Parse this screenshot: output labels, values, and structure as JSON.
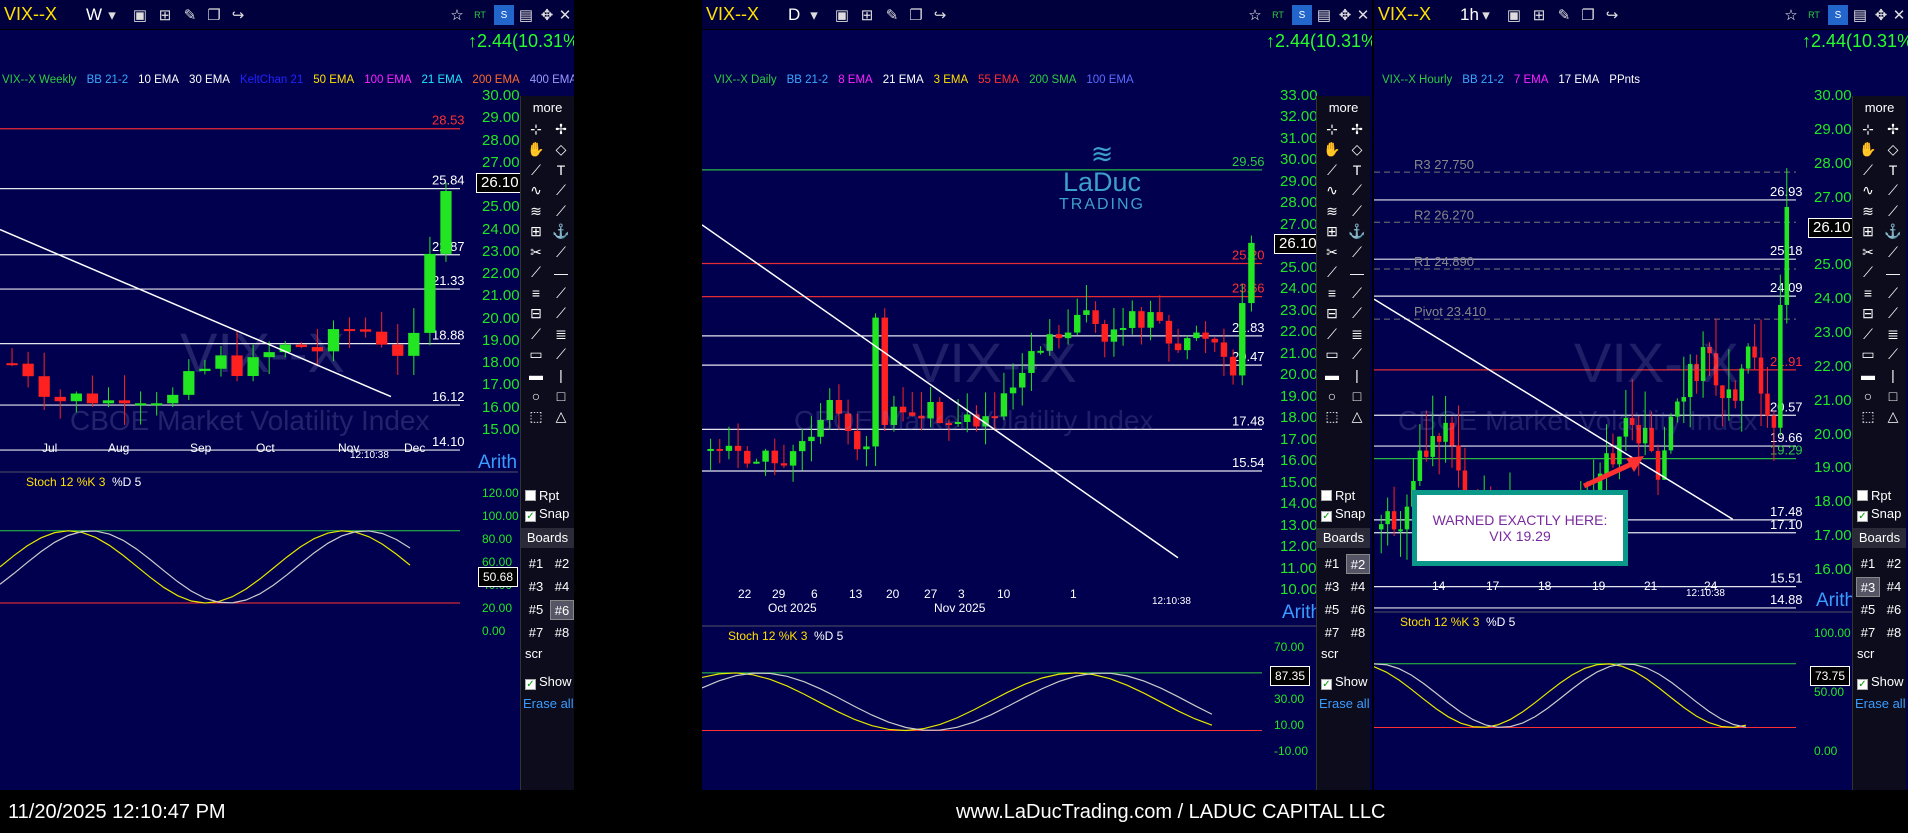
{
  "panels": [
    {
      "id": "weekly",
      "symbol": "VIX--X",
      "period": "W",
      "change": "↑2.44(10.31%)",
      "legend": [
        {
          "t": "VIX--X Weekly",
          "c": "#2ecc40"
        },
        {
          "t": "BB 21-2",
          "c": "#3aa8ff"
        },
        {
          "t": "10 EMA",
          "c": "#ffffff"
        },
        {
          "t": "30 EMA",
          "c": "#ffffff"
        },
        {
          "t": "KeltChan 21",
          "c": "#2222ff"
        },
        {
          "t": "50 EMA",
          "c": "#ffe000"
        },
        {
          "t": "100 EMA",
          "c": "#ff22ff"
        },
        {
          "t": "21 EMA",
          "c": "#22e6ff"
        },
        {
          "t": "200 EMA",
          "c": "#ff6a2a"
        },
        {
          "t": "400 EMA",
          "c": "#9a9aff"
        }
      ],
      "yaxis": [
        "30.00",
        "29.00",
        "28.00",
        "27.00",
        "26.00",
        "25.00",
        "24.00",
        "23.00",
        "22.00",
        "21.00",
        "20.00",
        "19.00",
        "18.00",
        "17.00",
        "16.00",
        "15.00"
      ],
      "levels": [
        {
          "v": "28.53",
          "c": "#ff3030"
        },
        {
          "v": "25.84",
          "c": "#ffffff"
        },
        {
          "v": "22.87",
          "c": "#ffffff"
        },
        {
          "v": "21.33",
          "c": "#ffffff"
        },
        {
          "v": "18.88",
          "c": "#ffffff"
        },
        {
          "v": "16.12",
          "c": "#ffffff"
        },
        {
          "v": "14.10",
          "c": "#ffffff"
        }
      ],
      "price": "26.10",
      "xaxis": [
        "Jul",
        "Aug",
        "Sep",
        "Oct",
        "Nov",
        "Dec"
      ],
      "time": "12:10:38",
      "ind_title": "Stoch 12 %K 3",
      "ind_title2": "%D 5",
      "ind_axis": [
        "120.00",
        "100.00",
        "80.00",
        "60.00",
        "40.00",
        "20.00",
        "0.00"
      ],
      "ind_value": "50.68",
      "watermark": "VIX--X",
      "watermark2": "CBOE Market Volatility Index"
    },
    {
      "id": "daily",
      "symbol": "VIX--X",
      "period": "D",
      "change": "↑2.44(10.31%)",
      "legend": [
        {
          "t": "VIX--X Daily",
          "c": "#2ecc40"
        },
        {
          "t": "BB 21-2",
          "c": "#3aa8ff"
        },
        {
          "t": "8 EMA",
          "c": "#ff22ff"
        },
        {
          "t": "21 EMA",
          "c": "#ffffff"
        },
        {
          "t": "3 EMA",
          "c": "#ffe000"
        },
        {
          "t": "55 EMA",
          "c": "#ff3030"
        },
        {
          "t": "200 SMA",
          "c": "#2ecc40"
        },
        {
          "t": "100 EMA",
          "c": "#5a6aff"
        }
      ],
      "yaxis": [
        "33.00",
        "32.00",
        "31.00",
        "30.00",
        "29.00",
        "28.00",
        "27.00",
        "26.00",
        "25.00",
        "24.00",
        "23.00",
        "22.00",
        "21.00",
        "20.00",
        "19.00",
        "18.00",
        "17.00",
        "16.00",
        "15.00",
        "14.00",
        "13.00",
        "12.00",
        "11.00",
        "10.00"
      ],
      "levels": [
        {
          "v": "29.56",
          "c": "#2ecc40"
        },
        {
          "v": "25.20",
          "c": "#ff3030"
        },
        {
          "v": "23.66",
          "c": "#ff3030"
        },
        {
          "v": "21.83",
          "c": "#ffffff"
        },
        {
          "v": "20.47",
          "c": "#ffffff"
        },
        {
          "v": "17.48",
          "c": "#ffffff"
        },
        {
          "v": "15.54",
          "c": "#ffffff"
        }
      ],
      "price": "26.10",
      "xaxis": [
        "22",
        "29",
        "6",
        "13",
        "20",
        "27",
        "3",
        "10",
        "1"
      ],
      "xaxis2": [
        "Oct 2025",
        "Nov 2025"
      ],
      "time": "12:10:38",
      "ind_title": "Stoch 12 %K 3",
      "ind_title2": "%D 5",
      "ind_axis": [
        "70.00",
        "50.00",
        "30.00",
        "10.00",
        "-10.00"
      ],
      "ind_value": "87.35",
      "watermark": "VIX--X",
      "watermark2": "CBOE Market Volatility Index",
      "brand": "LaDuc",
      "brand2": "TRADING"
    },
    {
      "id": "hourly",
      "symbol": "VIX--X",
      "period": "1h",
      "change": "↑2.44(10.31%)",
      "legend": [
        {
          "t": "VIX--X Hourly",
          "c": "#2ecc40"
        },
        {
          "t": "BB 21-2",
          "c": "#3aa8ff"
        },
        {
          "t": "7 EMA",
          "c": "#ff22ff"
        },
        {
          "t": "17 EMA",
          "c": "#ffffff"
        },
        {
          "t": "PPnts",
          "c": "#ffffff"
        }
      ],
      "yaxis": [
        "30.00",
        "29.00",
        "28.00",
        "27.00",
        "26.00",
        "25.00",
        "24.00",
        "23.00",
        "22.00",
        "21.00",
        "20.00",
        "19.00",
        "18.00",
        "17.00",
        "16.00"
      ],
      "levels": [
        {
          "v": "26.93",
          "c": "#ffffff"
        },
        {
          "v": "25.18",
          "c": "#ffffff"
        },
        {
          "v": "24.09",
          "c": "#ffffff"
        },
        {
          "v": "21.91",
          "c": "#ff3030"
        },
        {
          "v": "20.57",
          "c": "#ffffff"
        },
        {
          "v": "19.66",
          "c": "#ffffff"
        },
        {
          "v": "19.29",
          "c": "#2ecc40"
        },
        {
          "v": "17.48",
          "c": "#ffffff"
        },
        {
          "v": "17.10",
          "c": "#ffffff"
        },
        {
          "v": "15.51",
          "c": "#ffffff"
        },
        {
          "v": "14.88",
          "c": "#ffffff"
        }
      ],
      "pivots": [
        {
          "t": "R3 27.750"
        },
        {
          "t": "R2 26.270"
        },
        {
          "t": "R1 24.890"
        },
        {
          "t": "Pivot 23.410"
        }
      ],
      "price": "26.10",
      "xaxis": [
        "14",
        "17",
        "18",
        "19",
        "21",
        "24"
      ],
      "time": "12:10:38",
      "ind_title": "Stoch 12 %K 3",
      "ind_title2": "%D 5",
      "ind_axis": [
        "100.00",
        "50.00",
        "0.00"
      ],
      "ind_value": "73.75",
      "watermark": "VIX--X",
      "watermark2": "CBOE Market Volatility Index",
      "warning": "WARNED EXACTLY HERE:",
      "warning2": "VIX 19.29"
    }
  ],
  "toolbar": {
    "more": "more",
    "rpt": "Rpt",
    "snap": "Snap",
    "boards": "Boards",
    "b1": "#1",
    "b2": "#2",
    "b3": "#3",
    "b4": "#4",
    "b5": "#5",
    "b6": "#6",
    "b7": "#7",
    "b8": "#8",
    "scr": "scr",
    "show": "Show",
    "erase": "Erase all",
    "arith": "Arith"
  },
  "footer": {
    "timestamp": "11/20/2025 12:10:47 PM",
    "site": "www.LaDucTrading.com / LADUC CAPITAL LLC"
  },
  "colors": {
    "panel_bg": "#00004e",
    "up": "#22e622",
    "down": "#ff2020",
    "accent": "#3a9cff"
  }
}
